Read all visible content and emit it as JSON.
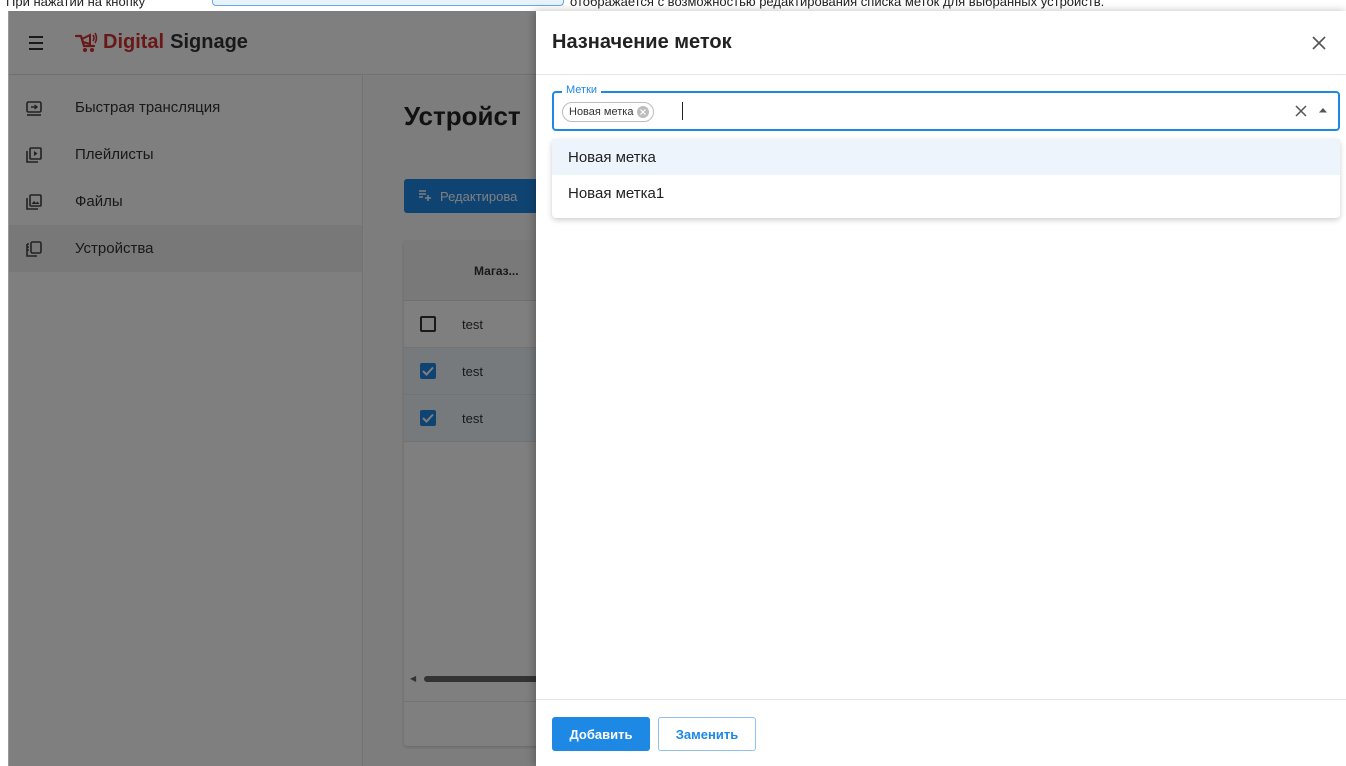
{
  "caption": {
    "text_before": "При нажатии на кнопку",
    "text_after": "отображается с возможностью редактирования списка меток для выбранных устройств."
  },
  "app": {
    "logo_accent": "Digital",
    "logo_rest": "Signage",
    "brand_color": "#d32f2f",
    "accent_color": "#1e88e5"
  },
  "sidebar": {
    "items": [
      {
        "label": "Быстрая трансляция",
        "icon": "cast-icon"
      },
      {
        "label": "Плейлисты",
        "icon": "playlist-icon"
      },
      {
        "label": "Файлы",
        "icon": "image-file-icon"
      },
      {
        "label": "Устройства",
        "icon": "devices-icon",
        "active": true
      }
    ]
  },
  "main": {
    "title": "Устройст",
    "edit_button": "Редактирова",
    "table": {
      "header": "Магаз...",
      "rows": [
        {
          "value": "test",
          "checked": false
        },
        {
          "value": "test",
          "checked": true
        },
        {
          "value": "test",
          "checked": true
        }
      ]
    }
  },
  "drawer": {
    "title": "Назначение меток",
    "field_label": "Метки",
    "chip": "Новая метка",
    "input_value": "",
    "options": [
      "Новая метка",
      "Новая метка1"
    ],
    "add_button": "Добавить",
    "replace_button": "Заменить"
  }
}
